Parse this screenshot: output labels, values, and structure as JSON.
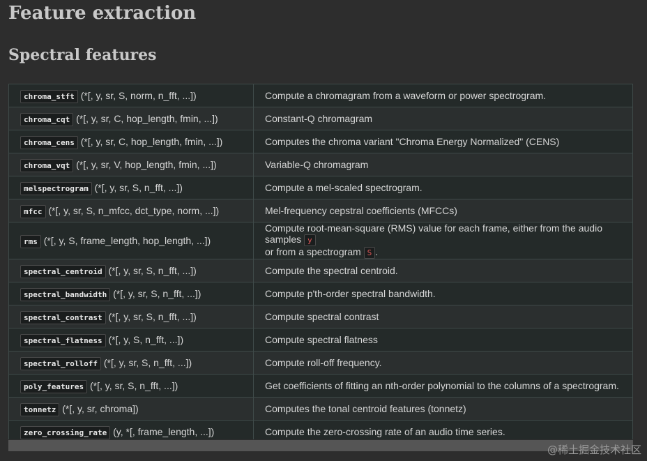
{
  "heading": "Feature extraction",
  "subheading": "Spectral features",
  "rows": [
    {
      "fn": "chroma_stft",
      "sig": "(*[, y, sr, S, norm, n_fft, ...])",
      "desc": "Compute a chromagram from a waveform or power spectrogram."
    },
    {
      "fn": "chroma_cqt",
      "sig": "(*[, y, sr, C, hop_length, fmin, ...])",
      "desc": "Constant-Q chromagram"
    },
    {
      "fn": "chroma_cens",
      "sig": "(*[, y, sr, C, hop_length, fmin, ...])",
      "desc": "Computes the chroma variant \"Chroma Energy Normalized\" (CENS)"
    },
    {
      "fn": "chroma_vqt",
      "sig": "(*[, y, sr, V, hop_length, fmin, ...])",
      "desc": "Variable-Q chromagram"
    },
    {
      "fn": "melspectrogram",
      "sig": "(*[, y, sr, S, n_fft, ...])",
      "desc": "Compute a mel-scaled spectrogram."
    },
    {
      "fn": "mfcc",
      "sig": "(*[, y, sr, S, n_mfcc, dct_type, norm, ...])",
      "desc": "Mel-frequency cepstral coefficients (MFCCs)"
    },
    {
      "fn": "rms",
      "sig": "(*[, y, S, frame_length, hop_length, ...])",
      "desc_a": "Compute root-mean-square (RMS) value for each frame, either from the audio samples",
      "code_y": "y",
      "desc_b": "or from a spectrogram",
      "code_s": "S",
      "desc_c": "."
    },
    {
      "fn": "spectral_centroid",
      "sig": "(*[, y, sr, S, n_fft, ...])",
      "desc": "Compute the spectral centroid."
    },
    {
      "fn": "spectral_bandwidth",
      "sig": "(*[, y, sr, S, n_fft, ...])",
      "desc": "Compute p'th-order spectral bandwidth."
    },
    {
      "fn": "spectral_contrast",
      "sig": "(*[, y, sr, S, n_fft, ...])",
      "desc": "Compute spectral contrast"
    },
    {
      "fn": "spectral_flatness",
      "sig": "(*[, y, S, n_fft, ...])",
      "desc": "Compute spectral flatness"
    },
    {
      "fn": "spectral_rolloff",
      "sig": "(*[, y, sr, S, n_fft, ...])",
      "desc": "Compute roll-off frequency."
    },
    {
      "fn": "poly_features",
      "sig": "(*[, y, sr, S, n_fft, ...])",
      "desc": "Get coefficients of fitting an nth-order polynomial to the columns of a spectrogram."
    },
    {
      "fn": "tonnetz",
      "sig": "(*[, y, sr, chroma])",
      "desc": "Computes the tonal centroid features (tonnetz)"
    },
    {
      "fn": "zero_crossing_rate",
      "sig": "(y, *[, frame_length, ...])",
      "desc": "Compute the zero-crossing rate of an audio time series."
    }
  ],
  "watermark": "@稀土掘金技术社区"
}
